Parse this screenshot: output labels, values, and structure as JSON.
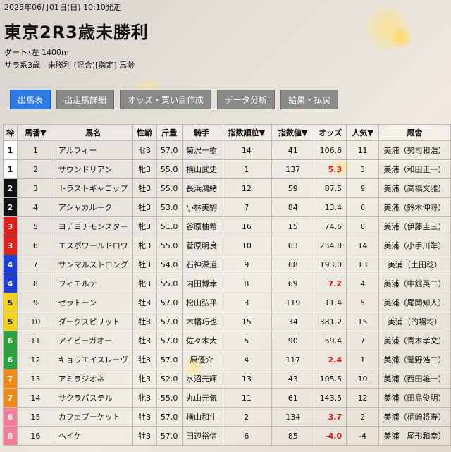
{
  "header": {
    "date": "2025年06月01日(日) 10:10発走",
    "title": "東京2R3歳未勝利",
    "course": "ダート･左 1400m",
    "conditions": "サラ系3歳　未勝利 (混合)[指定] 馬齢"
  },
  "tabs": [
    "出馬表",
    "出走馬詳細",
    "オッズ・買い目作成",
    "データ分析",
    "結果・払戻"
  ],
  "table": {
    "headers": [
      "枠",
      "馬番▼",
      "馬名",
      "性齢",
      "斤量",
      "騎手",
      "指数順位▼",
      "指数値▼",
      "オッズ",
      "人気▼",
      "厩舎"
    ],
    "waku_colors": {
      "1": {
        "bg": "#ffffff",
        "fg": "#111111"
      },
      "2": {
        "bg": "#111111",
        "fg": "#ffffff"
      },
      "3": {
        "bg": "#e0201b",
        "fg": "#ffffff"
      },
      "4": {
        "bg": "#1e3fd6",
        "fg": "#ffffff"
      },
      "5": {
        "bg": "#f3d41a",
        "fg": "#111111"
      },
      "6": {
        "bg": "#2aa23a",
        "fg": "#ffffff"
      },
      "7": {
        "bg": "#f08a17",
        "fg": "#ffffff"
      },
      "8": {
        "bg": "#f27e98",
        "fg": "#ffffff"
      }
    },
    "odds_highlight_color": "#d6161b",
    "rows": [
      {
        "waku": "1",
        "num": "1",
        "name": "アルフィー",
        "sex_age": "セ3",
        "weight": "57.0",
        "jockey": "菊沢一樹",
        "idx_rank": "14",
        "idx_val": "41",
        "odds": "106.6",
        "hot": false,
        "pop": "11",
        "stable": "美浦（勢司和浩）"
      },
      {
        "waku": "1",
        "num": "2",
        "name": "サウンドリアン",
        "sex_age": "牝3",
        "weight": "55.0",
        "jockey": "横山武史",
        "idx_rank": "1",
        "idx_val": "137",
        "odds": "5.3",
        "hot": true,
        "pop": "3",
        "stable": "美浦（和田正一）"
      },
      {
        "waku": "2",
        "num": "3",
        "name": "トラストギャロップ",
        "sex_age": "牡3",
        "weight": "55.0",
        "jockey": "長浜鴻緒",
        "idx_rank": "12",
        "idx_val": "59",
        "odds": "87.5",
        "hot": false,
        "pop": "9",
        "stable": "美浦（高橋文雅）"
      },
      {
        "waku": "2",
        "num": "4",
        "name": "アシャカルーク",
        "sex_age": "牡3",
        "weight": "53.0",
        "jockey": "小林美駒",
        "idx_rank": "7",
        "idx_val": "84",
        "odds": "13.4",
        "hot": false,
        "pop": "6",
        "stable": "美浦（鈴木伸尋）"
      },
      {
        "waku": "3",
        "num": "5",
        "name": "ヨチヨチモンスター",
        "sex_age": "牝3",
        "weight": "51.0",
        "jockey": "谷原柚希",
        "idx_rank": "16",
        "idx_val": "15",
        "odds": "74.6",
        "hot": false,
        "pop": "8",
        "stable": "美浦（伊藤圭三）"
      },
      {
        "waku": "3",
        "num": "6",
        "name": "エスポワールドロワ",
        "sex_age": "牝3",
        "weight": "55.0",
        "jockey": "菅原明良",
        "idx_rank": "10",
        "idx_val": "63",
        "odds": "254.8",
        "hot": false,
        "pop": "14",
        "stable": "美浦（小手川準）"
      },
      {
        "waku": "4",
        "num": "7",
        "name": "サンマルストロング",
        "sex_age": "牡3",
        "weight": "54.0",
        "jockey": "石神深道",
        "idx_rank": "9",
        "idx_val": "68",
        "odds": "193.0",
        "hot": false,
        "pop": "13",
        "stable": "美浦（土田稔）"
      },
      {
        "waku": "4",
        "num": "8",
        "name": "フィエルテ",
        "sex_age": "牝3",
        "weight": "55.0",
        "jockey": "内田博幸",
        "idx_rank": "8",
        "idx_val": "69",
        "odds": "7.2",
        "hot": true,
        "pop": "4",
        "stable": "美浦（中舘英二）"
      },
      {
        "waku": "5",
        "num": "9",
        "name": "セラトーン",
        "sex_age": "牡3",
        "weight": "57.0",
        "jockey": "松山弘平",
        "idx_rank": "3",
        "idx_val": "119",
        "odds": "11.4",
        "hot": false,
        "pop": "5",
        "stable": "美浦（尾関知人）"
      },
      {
        "waku": "5",
        "num": "10",
        "name": "ダークスピリット",
        "sex_age": "牡3",
        "weight": "57.0",
        "jockey": "木幡巧也",
        "idx_rank": "15",
        "idx_val": "34",
        "odds": "381.2",
        "hot": false,
        "pop": "15",
        "stable": "美浦（的場均）"
      },
      {
        "waku": "6",
        "num": "11",
        "name": "アイビーガオー",
        "sex_age": "牡3",
        "weight": "57.0",
        "jockey": "佐々木大",
        "idx_rank": "5",
        "idx_val": "90",
        "odds": "59.4",
        "hot": false,
        "pop": "7",
        "stable": "美浦（青木孝文）"
      },
      {
        "waku": "6",
        "num": "12",
        "name": "キョウエイスレーヴ",
        "sex_age": "牡3",
        "weight": "57.0",
        "jockey": "原優介",
        "idx_rank": "4",
        "idx_val": "117",
        "odds": "2.4",
        "hot": true,
        "pop": "1",
        "stable": "美浦（菅野浩二）"
      },
      {
        "waku": "7",
        "num": "13",
        "name": "アミラジオネ",
        "sex_age": "牝3",
        "weight": "52.0",
        "jockey": "水沼元輝",
        "idx_rank": "13",
        "idx_val": "43",
        "odds": "105.5",
        "hot": false,
        "pop": "10",
        "stable": "美浦（西田雄一）"
      },
      {
        "waku": "7",
        "num": "14",
        "name": "サクラパステル",
        "sex_age": "牝3",
        "weight": "55.0",
        "jockey": "丸山元気",
        "idx_rank": "11",
        "idx_val": "61",
        "odds": "143.5",
        "hot": false,
        "pop": "12",
        "stable": "美浦（田島俊明）"
      },
      {
        "waku": "8",
        "num": "15",
        "name": "カフェブーケット",
        "sex_age": "牡3",
        "weight": "57.0",
        "jockey": "横山和生",
        "idx_rank": "2",
        "idx_val": "134",
        "odds": "3.7",
        "hot": true,
        "pop": "2",
        "stable": "美浦（柄崎将寿）"
      },
      {
        "waku": "8",
        "num": "16",
        "name": "ヘイケ",
        "sex_age": "牡3",
        "weight": "57.0",
        "jockey": "田辺裕信",
        "idx_rank": "6",
        "idx_val": "85",
        "odds": "-4.0",
        "hot": true,
        "pop": "-4",
        "stable": "美浦　尾形和幸）"
      }
    ]
  }
}
